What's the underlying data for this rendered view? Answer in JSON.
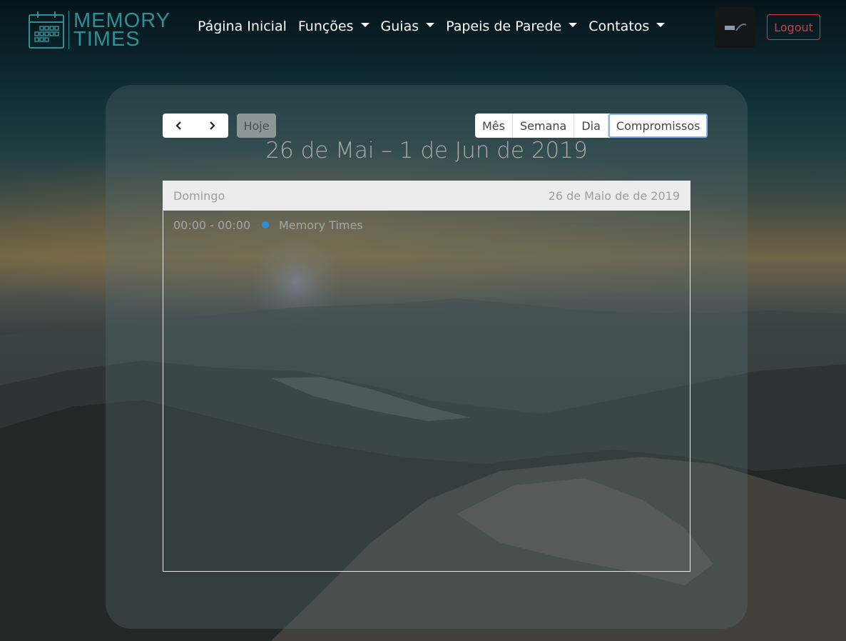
{
  "brand": {
    "line1": "MEMORY",
    "line2": "TIMES"
  },
  "nav": {
    "items": [
      {
        "label": "Página Inicial",
        "dropdown": false
      },
      {
        "label": "Funções",
        "dropdown": true
      },
      {
        "label": "Guias",
        "dropdown": true
      },
      {
        "label": "Papeis de Parede",
        "dropdown": true
      },
      {
        "label": "Contatos",
        "dropdown": true
      }
    ],
    "logout_label": "Logout"
  },
  "calendar": {
    "prev_icon": "chevron-left-icon",
    "next_icon": "chevron-right-icon",
    "today_label": "Hoje",
    "views": [
      {
        "label": "Mês",
        "active": false
      },
      {
        "label": "Semana",
        "active": false
      },
      {
        "label": "Dia",
        "active": false
      },
      {
        "label": "Compromissos",
        "active": true
      }
    ],
    "title": "26 de Mai – 1 de Jun de 2019",
    "list": {
      "day_name": "Domingo",
      "day_date": "26 de Maio de de 2019",
      "events": [
        {
          "time": "00:00 - 00:00",
          "title": "Memory Times",
          "color": "#2f8fd6"
        }
      ]
    }
  },
  "colors": {
    "brand": "#2f8f96",
    "logout": "#dc3545"
  }
}
